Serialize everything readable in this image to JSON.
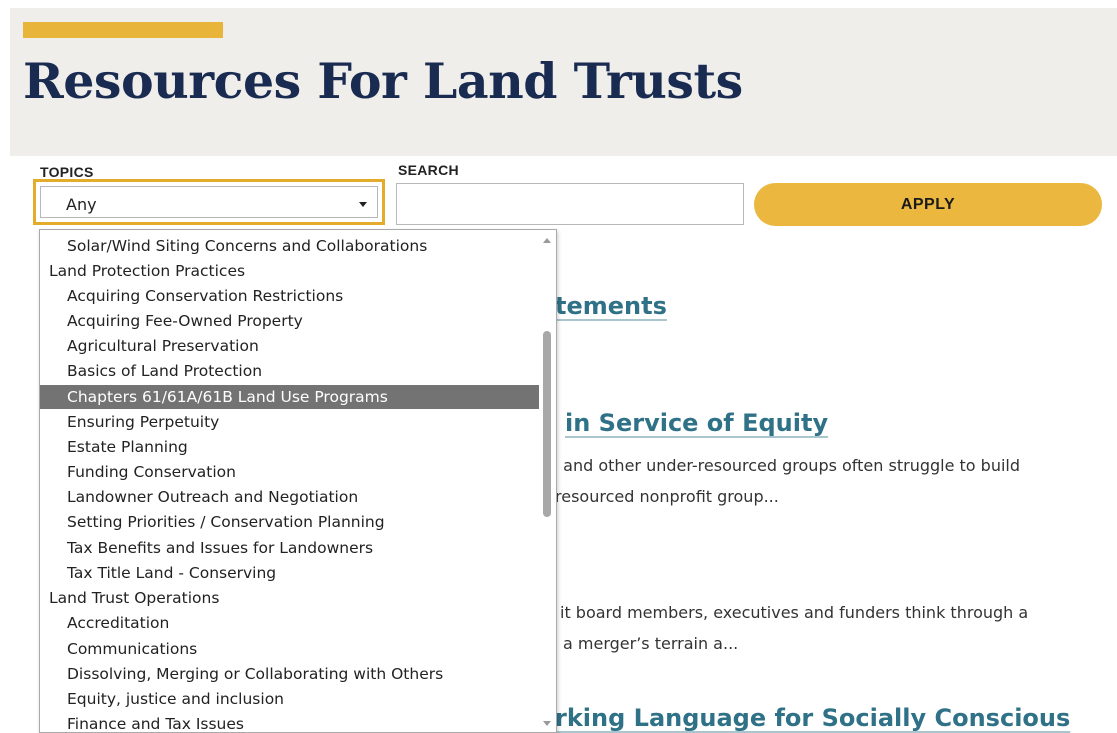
{
  "hero": {
    "title": "Resources For Land Trusts"
  },
  "filters": {
    "topics_label": "TOPICS",
    "topics_value": "Any",
    "search_label": "SEARCH",
    "search_value": "",
    "apply_label": "APPLY"
  },
  "dropdown": {
    "options": [
      {
        "label": "Solar/Wind Siting Concerns and Collaborations",
        "level": "child"
      },
      {
        "label": "Land Protection Practices",
        "level": "group"
      },
      {
        "label": "Acquiring Conservation Restrictions",
        "level": "child"
      },
      {
        "label": "Acquiring Fee-Owned Property",
        "level": "child"
      },
      {
        "label": "Agricultural Preservation",
        "level": "child"
      },
      {
        "label": "Basics of Land Protection",
        "level": "child"
      },
      {
        "label": "Chapters 61/61A/61B Land Use Programs",
        "level": "child",
        "selected": true
      },
      {
        "label": "Ensuring Perpetuity",
        "level": "child"
      },
      {
        "label": "Estate Planning",
        "level": "child"
      },
      {
        "label": "Funding Conservation",
        "level": "child"
      },
      {
        "label": "Landowner Outreach and Negotiation",
        "level": "child"
      },
      {
        "label": "Setting Priorities / Conservation Planning",
        "level": "child"
      },
      {
        "label": "Tax Benefits and Issues for Landowners",
        "level": "child"
      },
      {
        "label": "Tax Title Land - Conserving",
        "level": "child"
      },
      {
        "label": "Land Trust Operations",
        "level": "group"
      },
      {
        "label": "Accreditation",
        "level": "child"
      },
      {
        "label": "Communications",
        "level": "child"
      },
      {
        "label": "Dissolving, Merging or Collaborating with Others",
        "level": "child"
      },
      {
        "label": "Equity, justice and inclusion",
        "level": "child"
      },
      {
        "label": "Finance and Tax Issues",
        "level": "child"
      }
    ]
  },
  "results": {
    "r1_title": "tements",
    "r2_title": "in Service of Equity",
    "r2_line1": ", and other under-resourced groups often struggle to build",
    "r2_line2": "resourced nonprofit group...",
    "r3_line1": "it board members, executives and funders think through a",
    "r3_line2": "a merger’s terrain a...",
    "r4_title": "rking Language for Socially Conscious"
  },
  "colors": {
    "accent": "#e8b53a",
    "title": "#1a2b52",
    "link": "#2f7187",
    "selected_option": "#737373"
  }
}
